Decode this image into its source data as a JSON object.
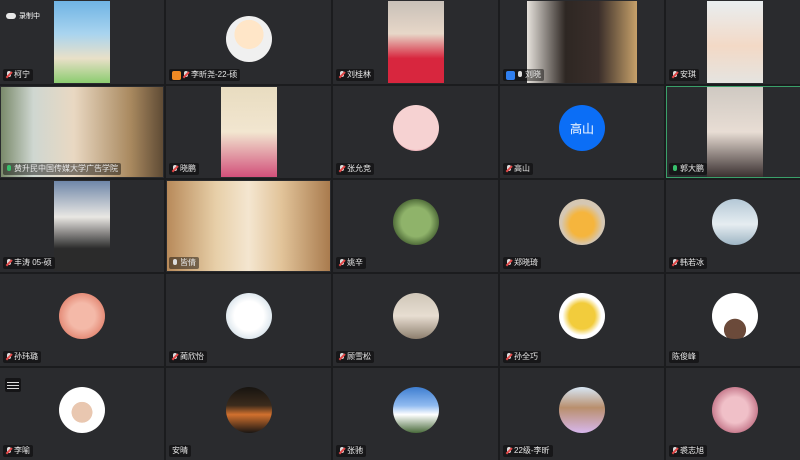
{
  "recording": {
    "label": "录制中"
  },
  "participants": [
    {
      "name": "柯宁",
      "mic": "muted",
      "view": "video",
      "bg": "linear-gradient(180deg,#6fb3e4 0%,#a9d4ef 40%,#e9e0c8 70%,#8ccc70 100%)"
    },
    {
      "name": "李昕尧-22-硕",
      "mic": "muted",
      "badge": "host",
      "view": "avatar",
      "bg": "radial-gradient(circle at 50% 40%,#ffe6c8 0 40%,#f0f0f0 41%)"
    },
    {
      "name": "刘桂林",
      "mic": "muted",
      "view": "video",
      "bg": "linear-gradient(180deg,#c8c0b8 0%,#e7d7c8 40%,#d8263e 70%)"
    },
    {
      "name": "刘晓",
      "mic": "on",
      "badge": "cohost",
      "view": "video-wide",
      "bg": "linear-gradient(90deg,#e6e2dc 0%,#2e2723 35%,#3a2e2a 65%,#c7a16a 100%)"
    },
    {
      "name": "安琪",
      "mic": "muted",
      "view": "video",
      "bg": "linear-gradient(180deg,#e9eef0 0%,#f3d9c6 55%,#e5e4e0 100%)"
    },
    {
      "name": "黄升民中国传媒大学广告学院",
      "mic": "green",
      "view": "video-full",
      "bg": "linear-gradient(90deg,#7a8a6b 0%,#cfd7d1 20%,#e9d8c2 45%,#a9895f 80%,#5f4b35 100%)"
    },
    {
      "name": "晓鹏",
      "mic": "muted",
      "view": "video",
      "bg": "linear-gradient(180deg,#e8dcc0 0%,#f2e6d0 50%,#d2507a 100%)"
    },
    {
      "name": "张允竞",
      "mic": "muted",
      "view": "avatar",
      "bg": "radial-gradient(circle at 50% 45%,#f6d2d2 0 70%,#f1b9bf 71%)"
    },
    {
      "name": "高山",
      "mic": "muted",
      "view": "avatar-text",
      "avatar_text": "高山"
    },
    {
      "name": "郭大鹏",
      "mic": "green",
      "view": "video",
      "active": true,
      "bg": "linear-gradient(180deg,#cfc9c2 0%,#e8ddd4 50%,#3a3030 100%)"
    },
    {
      "name": "丰涛 05-硕",
      "mic": "muted",
      "view": "video",
      "bg": "linear-gradient(180deg,#6f87a9 0%,#e9e7e3 40%,#2b2b2b 75%)"
    },
    {
      "name": "皆倩",
      "mic": "on",
      "view": "video-full",
      "bg": "linear-gradient(90deg,#b88a5a 0%,#e7cfa8 30%,#f4e6d0 50%,#e2c49a 70%,#a97b4e 100%)"
    },
    {
      "name": "姚辛",
      "mic": "muted",
      "view": "avatar",
      "bg": "radial-gradient(circle at 50% 50%,#8fb36a 0 45%,#53703c 70%)"
    },
    {
      "name": "郑晓琦",
      "mic": "muted",
      "view": "avatar",
      "bg": "radial-gradient(circle at 50% 55%,#f5b53d 0 35%,#d5c7b3 60%)"
    },
    {
      "name": "韩若冰",
      "mic": "muted",
      "view": "avatar",
      "bg": "linear-gradient(180deg,#b4c8d6 0%,#e6edf1 55%,#9eb5c4 100%)"
    },
    {
      "name": "孙玮璐",
      "mic": "muted",
      "view": "avatar",
      "bg": "radial-gradient(circle at 50% 50%,#f4b9a8 0 40%,#e58d79 70%)"
    },
    {
      "name": "蔺欣怡",
      "mic": "muted",
      "view": "avatar",
      "bg": "radial-gradient(circle at 50% 50%,#ffffff 0 45%,#dfe8ee 70%)"
    },
    {
      "name": "顾雪松",
      "mic": "muted",
      "view": "avatar",
      "bg": "linear-gradient(180deg,#cfc6b8 0%,#e7ddd1 50%,#8d7f6e 100%)"
    },
    {
      "name": "孙全巧",
      "mic": "muted",
      "view": "avatar",
      "bg": "radial-gradient(circle at 50% 50%,#f2cc3c 0 40%,#ffffff 60%)"
    },
    {
      "name": "陈俊峰",
      "mic": "none",
      "view": "avatar",
      "bg": "radial-gradient(circle at 50% 80%,#6b4a3a 0 25%,#ffffff 26%)"
    },
    {
      "name": "李喻",
      "mic": "muted",
      "view": "avatar",
      "menu": true,
      "bg": "radial-gradient(circle at 50% 55%,#e9c7b0 0 30%,#ffffff 31%)"
    },
    {
      "name": "安晴",
      "mic": "none",
      "view": "avatar",
      "bg": "linear-gradient(180deg,#171410 0%,#3b2b1c 40%,#d2712e 60%,#1a1613 100%)"
    },
    {
      "name": "张驰",
      "mic": "muted",
      "view": "avatar",
      "bg": "linear-gradient(180deg,#3e7ed0 0%,#8fbaf0 40%,#ffffff 60%,#496b3b 100%)"
    },
    {
      "name": "22级-李昕",
      "mic": "muted",
      "view": "avatar",
      "bg": "linear-gradient(180deg,#d7e6f4 0%,#b98f6d 45%,#d7b7ec 100%)"
    },
    {
      "name": "裘志旭",
      "mic": "muted",
      "view": "avatar",
      "bg": "radial-gradient(circle at 50% 50%,#f0c0c8 0 40%,#c97e90 70%)"
    }
  ]
}
